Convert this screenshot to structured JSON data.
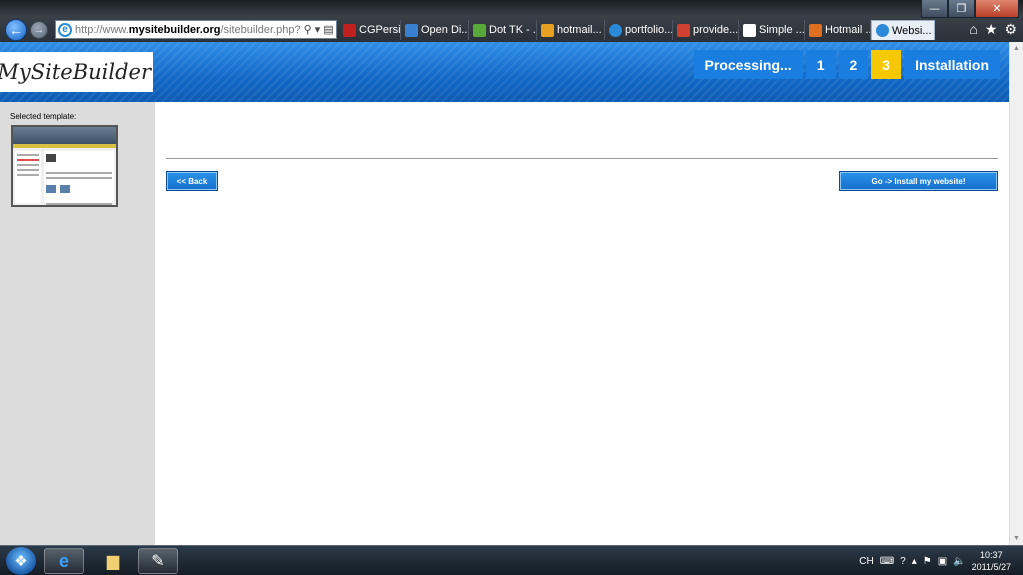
{
  "browser": {
    "address": {
      "prefix": "http://www.",
      "domain": "mysitebuilder.org",
      "path": "/sitebuilder.php?"
    },
    "tabs": [
      {
        "label": "CGPersia...",
        "color": "#c02020"
      },
      {
        "label": "Open Di...",
        "color": "#3a7fd0"
      },
      {
        "label": "Dot TK - ...",
        "color": "#5aa83a"
      },
      {
        "label": "hotmail...",
        "color": "#e8a020"
      },
      {
        "label": "portfolio...",
        "color": "#2a8ad8"
      },
      {
        "label": "provide...",
        "color": "#d04030"
      },
      {
        "label": "Simple ...",
        "color": "#ffffff"
      },
      {
        "label": "Hotmail ...",
        "color": "#e07020"
      },
      {
        "label": "Websi...",
        "color": "#2a8ad8"
      }
    ],
    "tab_close": "×",
    "win_minimize": "—",
    "win_restore": "❐",
    "win_close": "✕",
    "back_glyph": "←",
    "forward_glyph": "→",
    "addr_icons": [
      "⚲",
      "▾",
      "▤",
      "↻",
      "✕"
    ],
    "chrome_icons": [
      "⌂",
      "★",
      "⚙"
    ]
  },
  "header": {
    "logo": "MySiteBuilder",
    "steps": [
      {
        "label": "Processing...",
        "current": false
      },
      {
        "label": "1",
        "current": false
      },
      {
        "label": "2",
        "current": false
      },
      {
        "label": "3",
        "current": true
      },
      {
        "label": "Installation",
        "current": false
      }
    ]
  },
  "sidebar": {
    "selected_label": "Selected template:"
  },
  "main": {
    "back_label": "<< Back",
    "install_label": "Go -> Install my website!"
  },
  "taskbar": {
    "tray_lang": "CH",
    "time": "10:37",
    "date": "2011/5/27"
  }
}
